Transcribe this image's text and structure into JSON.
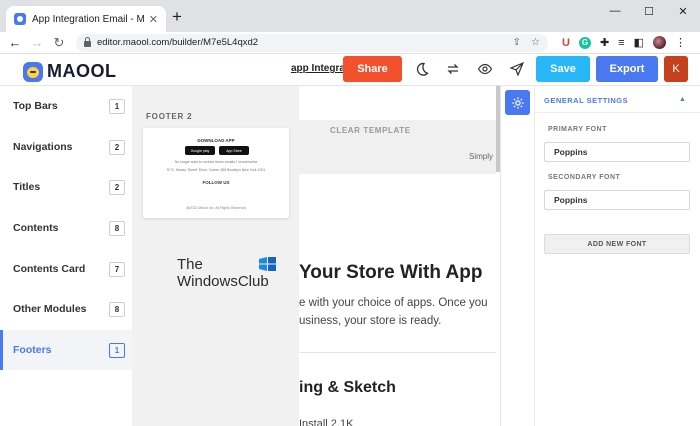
{
  "browser": {
    "tab_title": "App Integration Email - Maool",
    "tab_close": "✕",
    "new_tab": "+",
    "url": "editor.maool.com/builder/M7e5L4qxd2",
    "window_controls": {
      "minimize": "—",
      "maximize": "☐",
      "close": "✕"
    }
  },
  "header": {
    "logo_text": "MAOOL",
    "template_name": "app Integration Email",
    "share_label": "Share",
    "save_label": "Save",
    "export_label": "Export",
    "user_initial": "K"
  },
  "sidebar": {
    "items": [
      {
        "label": "Top Bars",
        "count": "1"
      },
      {
        "label": "Navigations",
        "count": "2"
      },
      {
        "label": "Titles",
        "count": "2"
      },
      {
        "label": "Contents",
        "count": "8"
      },
      {
        "label": "Contents Card",
        "count": "7"
      },
      {
        "label": "Other Modules",
        "count": "8"
      },
      {
        "label": "Footers",
        "count": "1"
      }
    ]
  },
  "flyout": {
    "title": "FOOTER 2",
    "card": {
      "download_heading": "DOWNLOAD APP",
      "google_badge": "Google play",
      "apple_badge": "App Store",
      "unsubscribe_line": "No longer want to receive these emails? Unsubscribe",
      "address_line": "97 E. Mosey 'Street' Drive, Comer 456 Brooklyn New York 1001",
      "follow_heading": "FOLLOW US",
      "copyright": "@2022 Maool Inc. All Rights Reserved"
    }
  },
  "canvas": {
    "clear_template": "CLEAR TEMPLATE",
    "simply_text": "Simply",
    "heading1": "Your Store With App",
    "para1_line1": "e with your choice of apps. Once you",
    "para1_line2": "usiness, your store is ready.",
    "heading2": "ing & Sketch",
    "para2": "Install 2.1K"
  },
  "watermark": {
    "line1": "The",
    "line2": "WindowsClub"
  },
  "settings": {
    "heading": "GENERAL SETTINGS",
    "caret": "▲",
    "primary_label": "PRIMARY FONT",
    "primary_value": "Poppins",
    "secondary_label": "SECONDARY FONT",
    "secondary_value": "Poppins",
    "add_font_label": "ADD NEW FONT"
  },
  "colors": {
    "accent": "#4a78f0",
    "share": "#f2512c",
    "save": "#29b6f6",
    "avatar": "#c4401f"
  }
}
